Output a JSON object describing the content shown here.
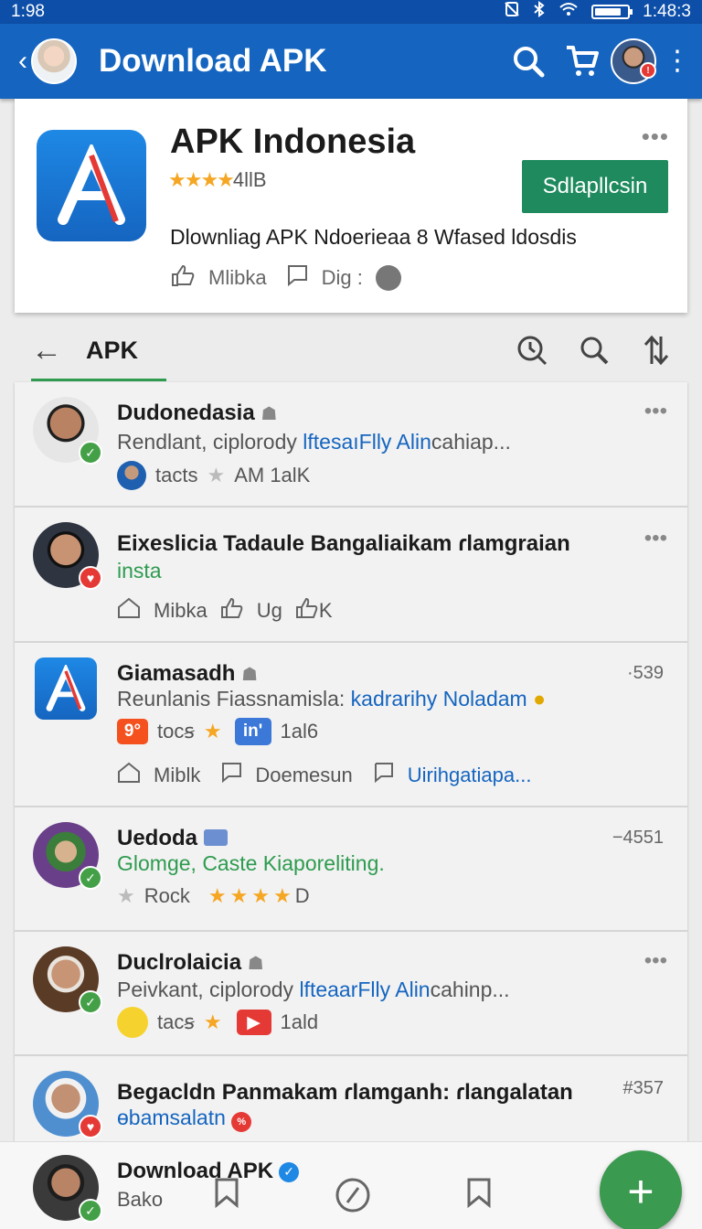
{
  "status_bar": {
    "time_left": "1:98",
    "time_right": "1:48:3",
    "battery_level": 0.85
  },
  "app_bar": {
    "title": "Download APK"
  },
  "app_card": {
    "name": "APK Indonesia",
    "stars": "★★★★",
    "rating": "4llB",
    "install_label": "Sdlapllcsin",
    "description": "Dlownliag APK Ndoerieaa 8  Wfased ldosdis",
    "action_like": "Mlibka",
    "action_dig": "Dig :"
  },
  "tabs": {
    "active": "APK"
  },
  "feed": [
    {
      "title": "Dudonedasia",
      "sub_prefix": "Rendlant, ciplorody ",
      "sub_link": "lftesaıFlly Alin",
      "sub_suffix": "cahiap...",
      "meta_a": "tacts",
      "meta_b": "AM 1alK"
    },
    {
      "title": "Eixeslicia Tadaule Bangaliaikam ɾlamgraian",
      "sub": "insta",
      "act_1": "Mibka",
      "act_2": "Ug",
      "act_3": "K"
    },
    {
      "title": "Giamasadh",
      "num": "·539",
      "sub_prefix": "Reunlanis Fiassnamisla: ",
      "sub_link": "kadrarihy Noladam",
      "chip_num": "9°",
      "meta_a": "tocꞩ",
      "chip_in": "in'",
      "meta_b": "1al6",
      "act_1": "Miblk",
      "act_2": "Doemesun",
      "act_3": "Uirihgatiapa..."
    },
    {
      "title": "Uedoda",
      "num": "−4551",
      "sub": "Glomge, Caste Kiaporeliting.",
      "meta_a": "Rock",
      "stars": "★★★★",
      "meta_b": "D"
    },
    {
      "title": "Duclrolaicia",
      "sub_prefix": "Peivkant, ciplorody ",
      "sub_link": "lfteaarFlly Alin",
      "sub_suffix": "cahinp...",
      "meta_a": "tacꞩ",
      "meta_b": "1ald"
    },
    {
      "title": "Begacldn Panmakam ɾlamganh: ɾlangalatan",
      "num": "#357",
      "sub": "ɵbamsalatn"
    }
  ],
  "bottom_bar": {
    "title": "Download APK",
    "subtitle": "Bako"
  },
  "colors": {
    "primary": "#1565c0",
    "accent_green": "#1e8a5e",
    "star": "#f5a623"
  }
}
